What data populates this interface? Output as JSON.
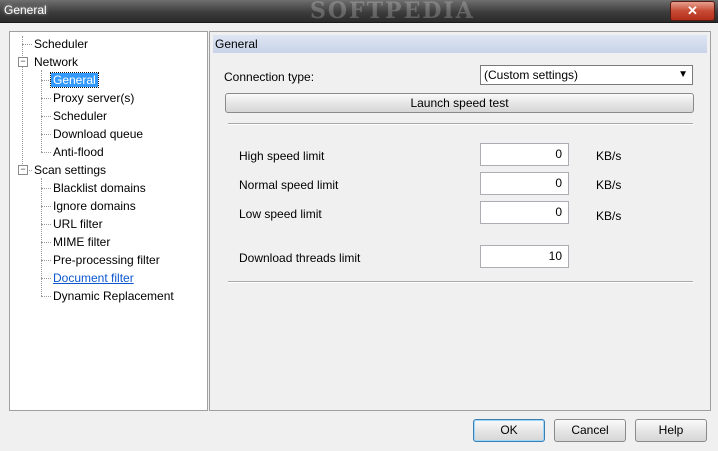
{
  "window": {
    "title": "General",
    "watermark": "SOFTPEDIA",
    "close_glyph": "✕"
  },
  "tree": {
    "items": [
      {
        "label": "Scheduler"
      },
      {
        "label": "Network"
      },
      {
        "label": "General"
      },
      {
        "label": "Proxy server(s)"
      },
      {
        "label": "Scheduler"
      },
      {
        "label": "Download queue"
      },
      {
        "label": "Anti-flood"
      },
      {
        "label": "Scan settings"
      },
      {
        "label": "Blacklist domains"
      },
      {
        "label": "Ignore domains"
      },
      {
        "label": "URL filter"
      },
      {
        "label": "MIME filter"
      },
      {
        "label": "Pre-processing filter"
      },
      {
        "label": "Document filter"
      },
      {
        "label": "Dynamic Replacement"
      }
    ],
    "expander_glyph": "−"
  },
  "panel": {
    "header": "General",
    "connection_type_label": "Connection type:",
    "connection_type_value": "(Custom settings)",
    "launch_button": "Launch speed test",
    "high_speed_label": "High speed limit",
    "high_speed_value": "0",
    "normal_speed_label": "Normal speed limit",
    "normal_speed_value": "0",
    "low_speed_label": "Low speed limit",
    "low_speed_value": "0",
    "unit": "KB/s",
    "threads_label": "Download threads limit",
    "threads_value": "10"
  },
  "buttons": {
    "ok": "OK",
    "cancel": "Cancel",
    "help": "Help"
  }
}
